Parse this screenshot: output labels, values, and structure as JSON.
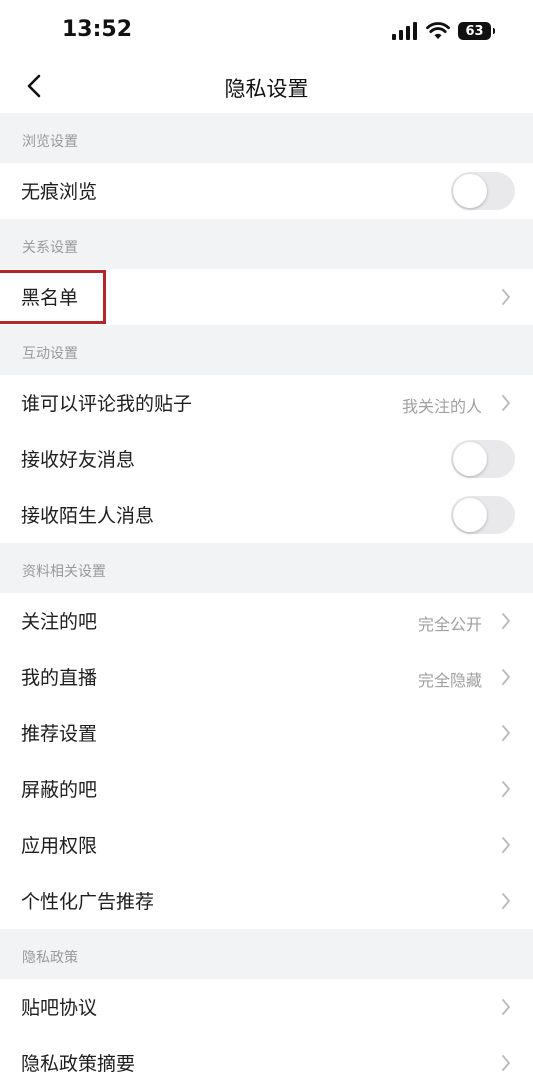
{
  "status_bar": {
    "time": "13:52",
    "battery": "63"
  },
  "nav": {
    "title": "隐私设置"
  },
  "sections": {
    "browse": {
      "header": "浏览设置",
      "incognito": {
        "label": "无痕浏览",
        "enabled": false
      }
    },
    "relation": {
      "header": "关系设置",
      "blacklist": {
        "label": "黑名单"
      }
    },
    "interaction": {
      "header": "互动设置",
      "comment": {
        "label": "谁可以评论我的贴子",
        "value": "我关注的人"
      },
      "friend_msg": {
        "label": "接收好友消息",
        "enabled": false
      },
      "stranger_msg": {
        "label": "接收陌生人消息",
        "enabled": false
      }
    },
    "profile": {
      "header": "资料相关设置",
      "followed_bars": {
        "label": "关注的吧",
        "value": "完全公开"
      },
      "live": {
        "label": "我的直播",
        "value": "完全隐藏"
      },
      "recommend": {
        "label": "推荐设置"
      },
      "blocked_bars": {
        "label": "屏蔽的吧"
      },
      "permissions": {
        "label": "应用权限"
      },
      "ads": {
        "label": "个性化广告推荐"
      }
    },
    "policy": {
      "header": "隐私政策",
      "agreement": {
        "label": "贴吧协议"
      },
      "summary": {
        "label": "隐私政策摘要"
      }
    }
  },
  "colors": {
    "highlight": "#b3262a",
    "toggle_off": "#e9e9eb"
  }
}
